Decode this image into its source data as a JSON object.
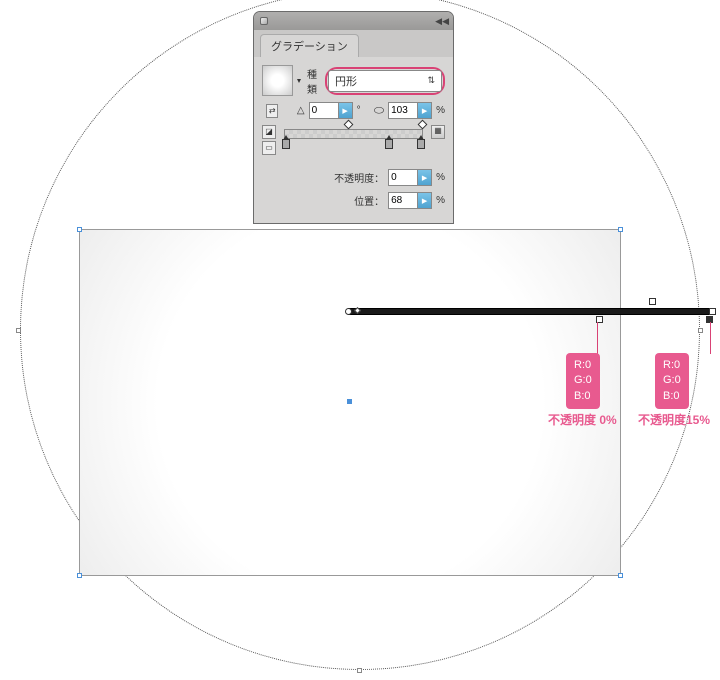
{
  "panel": {
    "title": "グラデーション",
    "type_label": "種類",
    "type_value": "円形",
    "angle_icon": "△",
    "angle_value": "0",
    "aspect_icon": "⬭",
    "aspect_value": "103",
    "percent": "%",
    "degree": "°",
    "opacity_label": "不透明度：",
    "opacity_value": "0",
    "position_label": "位置：",
    "position_value": "68"
  },
  "stop1": {
    "r": "R:0",
    "g": "G:0",
    "b": "B:0",
    "opacity": "不透明度 0%"
  },
  "stop2": {
    "r": "R:0",
    "g": "G:0",
    "b": "B:0",
    "opacity": "不透明度15%"
  }
}
